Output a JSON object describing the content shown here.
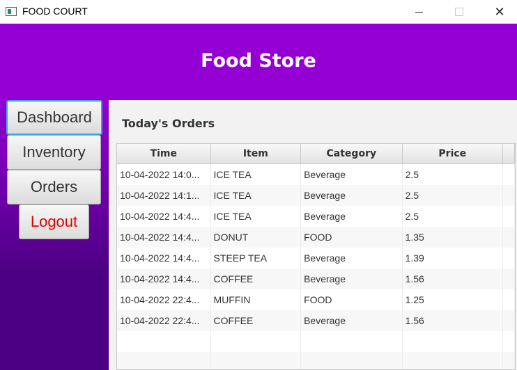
{
  "window": {
    "title": "FOOD COURT",
    "close_glyph": "✕"
  },
  "header": {
    "title": "Food Store"
  },
  "sidebar": {
    "items": [
      {
        "label": "Dashboard"
      },
      {
        "label": "Inventory"
      },
      {
        "label": "Orders"
      },
      {
        "label": "Logout"
      }
    ]
  },
  "main": {
    "section_title": "Today's Orders",
    "table": {
      "columns": [
        "Time",
        "Item",
        "Category",
        "Price"
      ],
      "rows": [
        [
          "10-04-2022 14:0...",
          "ICE TEA",
          "Beverage",
          "2.5"
        ],
        [
          "10-04-2022 14:1...",
          "ICE TEA",
          "Beverage",
          "2.5"
        ],
        [
          "10-04-2022 14:4...",
          "ICE TEA",
          "Beverage",
          "2.5"
        ],
        [
          "10-04-2022 14:4...",
          "DONUT",
          "FOOD",
          "1.35"
        ],
        [
          "10-04-2022 14:4...",
          "STEEP TEA",
          "Beverage",
          "1.39"
        ],
        [
          "10-04-2022 14:4...",
          "COFFEE",
          "Beverage",
          "1.56"
        ],
        [
          "10-04-2022 22:4...",
          "MUFFIN",
          "FOOD",
          "1.25"
        ],
        [
          "10-04-2022 22:4...",
          "COFFEE",
          "Beverage",
          "1.56"
        ]
      ],
      "empty_rows": 2
    }
  },
  "colors": {
    "header_bg": "#9400d3",
    "sidebar_bottom": "#4b0082",
    "logout_text": "#e00000",
    "focus_border": "#3aa6e0"
  },
  "icons": [
    "app-icon",
    "minimize-icon",
    "maximize-icon",
    "close-icon"
  ]
}
